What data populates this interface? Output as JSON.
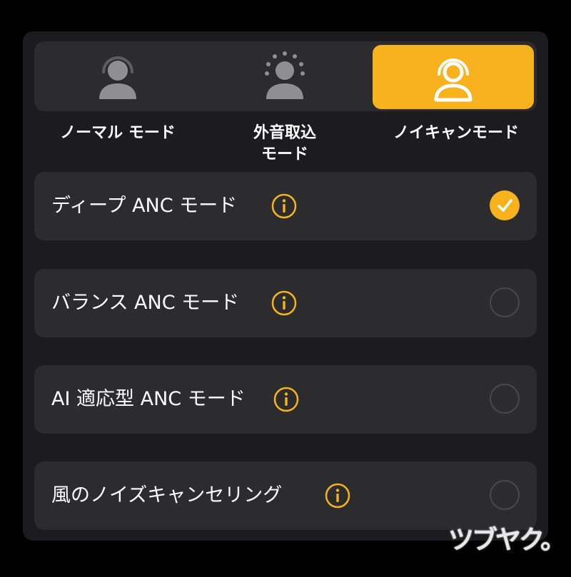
{
  "modes": [
    {
      "label": "ノーマル モード",
      "icon": "person-normal-icon",
      "selected": false
    },
    {
      "label_line1": "外音取込",
      "label_line2": "モード",
      "icon": "person-ambient-icon",
      "selected": false
    },
    {
      "label": "ノイキャンモード",
      "icon": "person-noise-cancel-icon",
      "selected": true
    }
  ],
  "options": [
    {
      "label": "ディープ ANC モード",
      "selected": true
    },
    {
      "label": "バランス ANC モード",
      "selected": false
    },
    {
      "label": "AI 適応型 ANC モード",
      "selected": false
    },
    {
      "label": "風のノイズキャンセリング",
      "selected": false
    }
  ],
  "watermark": "ツブヤク。",
  "colors": {
    "accent": "#f7b21d",
    "panel": "#1c1c1e",
    "row": "#2c2c2e",
    "icon_inactive": "#8e8e93"
  }
}
